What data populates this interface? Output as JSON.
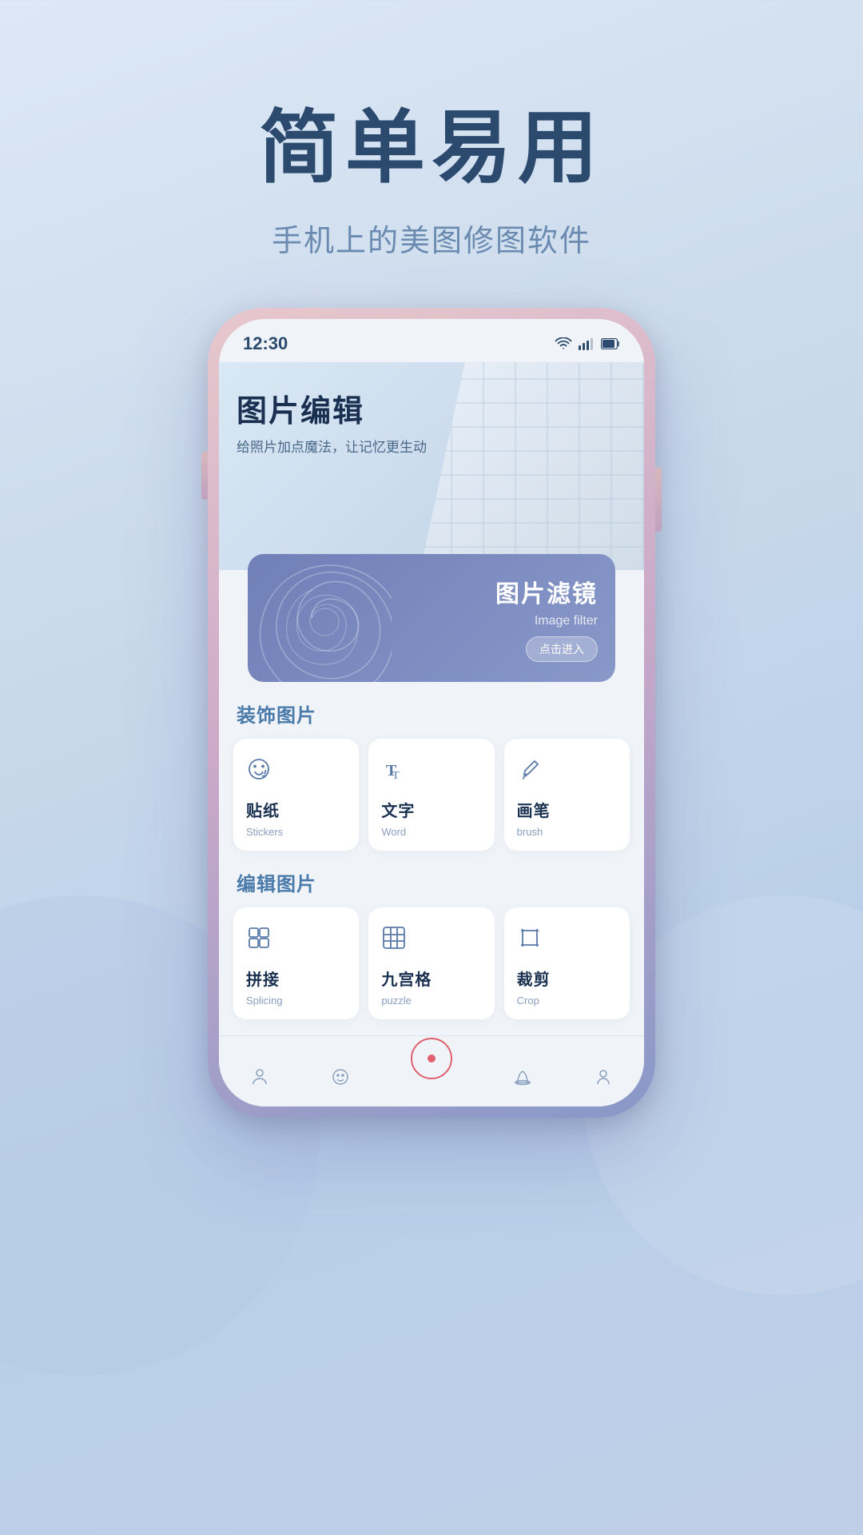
{
  "hero": {
    "title": "简单易用",
    "subtitle": "手机上的美图修图软件"
  },
  "phone": {
    "status_bar": {
      "time": "12:30",
      "icons": [
        "wifi",
        "signal",
        "battery"
      ]
    },
    "banner": {
      "title": "图片编辑",
      "subtitle": "给照片加点魔法，让记忆更生动"
    },
    "filter_card": {
      "title_cn": "图片滤镜",
      "title_en": "Image filter",
      "button": "点击进入"
    },
    "section1": {
      "label": "装饰",
      "label2": "图片"
    },
    "section2": {
      "label": "编辑",
      "label2": "图片"
    },
    "features_decorate": [
      {
        "icon": "sticker",
        "name_cn": "贴纸",
        "name_en": "Stickers"
      },
      {
        "icon": "text",
        "name_cn": "文字",
        "name_en": "Word"
      },
      {
        "icon": "brush",
        "name_cn": "画笔",
        "name_en": "brush"
      }
    ],
    "features_edit": [
      {
        "icon": "splice",
        "name_cn": "拼接",
        "name_en": "Splicing"
      },
      {
        "icon": "grid",
        "name_cn": "九宫格",
        "name_en": "puzzle"
      },
      {
        "icon": "crop",
        "name_cn": "裁剪",
        "name_en": "Crop"
      }
    ],
    "nav": {
      "items": [
        {
          "icon": "person",
          "label": ""
        },
        {
          "icon": "face",
          "label": ""
        },
        {
          "icon": "center",
          "label": ""
        },
        {
          "icon": "hat",
          "label": ""
        },
        {
          "icon": "person2",
          "label": ""
        }
      ]
    }
  }
}
